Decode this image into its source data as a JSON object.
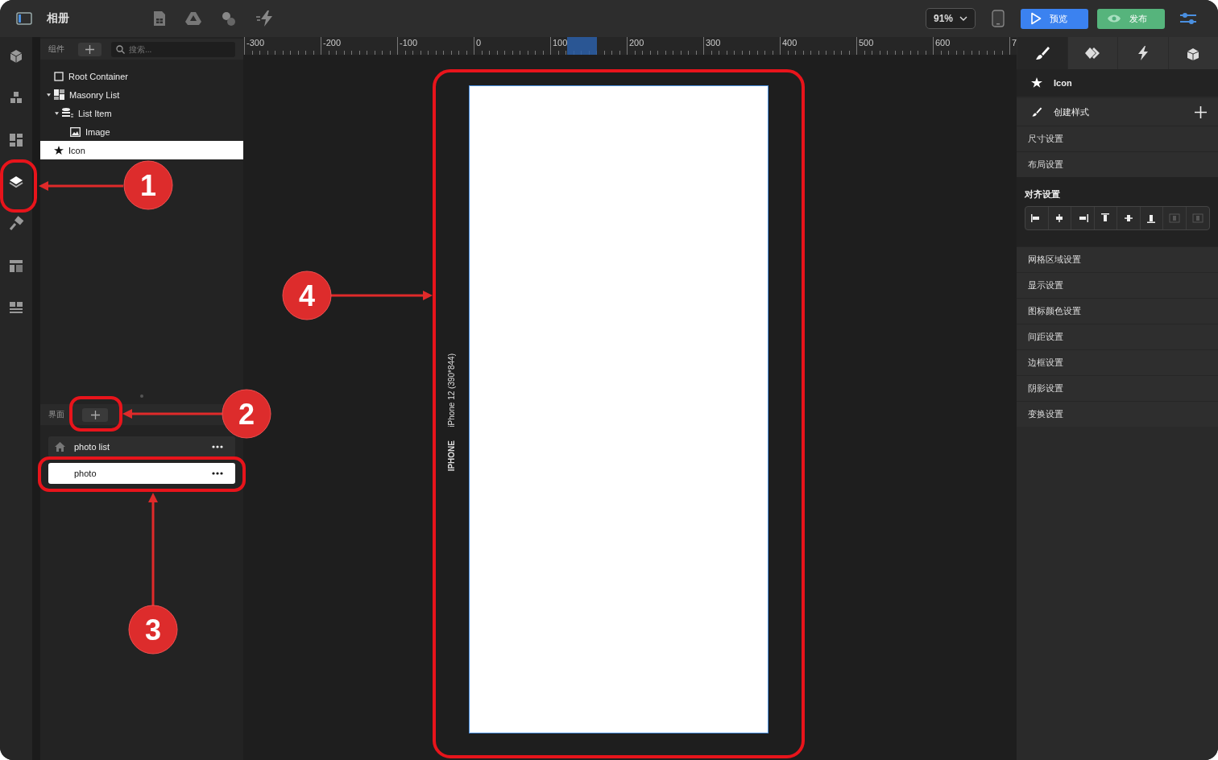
{
  "app": {
    "title": "相册"
  },
  "zoom": "91%",
  "buttons": [
    {
      "label": "预览",
      "kind": "preview"
    },
    {
      "label": "发布",
      "kind": "publish"
    }
  ],
  "rail_items": [
    {
      "selected": false
    },
    {
      "selected": false
    },
    {
      "selected": false
    },
    {
      "selected": true
    },
    {
      "selected": false
    },
    {
      "selected": false
    },
    {
      "selected": false
    }
  ],
  "components_panel": {
    "label": "组件",
    "search": {
      "placeholder": "搜索..."
    }
  },
  "tree": [
    {
      "label": "Root Container",
      "kind": "container",
      "selected": false
    },
    {
      "label": "Masonry List",
      "kind": "masonry",
      "expanded": true,
      "selected": false,
      "children": [
        {
          "label": "List Item",
          "kind": "list-item",
          "expanded": true,
          "selected": false,
          "children": [
            {
              "label": "Image",
              "kind": "image",
              "selected": false
            }
          ]
        }
      ]
    },
    {
      "label": "Icon",
      "kind": "icon",
      "selected": true
    }
  ],
  "pages_panel": {
    "label": "界面"
  },
  "pages": [
    {
      "label": "photo list",
      "home": true,
      "selected": false
    },
    {
      "label": "photo",
      "home": false,
      "selected": true
    }
  ],
  "ruler": [
    "-300",
    "-200",
    "-100",
    "0",
    "100",
    "200",
    "300",
    "400",
    "500",
    "600",
    "7"
  ],
  "device": {
    "name": "IPHONE",
    "model": "iPhone 12 (390*844)"
  },
  "inspector": {
    "tabs": [
      {
        "selected": true
      },
      {
        "selected": false
      },
      {
        "selected": false
      },
      {
        "selected": false
      }
    ],
    "element": "Icon",
    "create_style": "创建样式",
    "sections_top": [
      "尺寸设置",
      "布局设置"
    ],
    "align": {
      "title": "对齐设置",
      "buttons": [
        {
          "disabled": false
        },
        {
          "disabled": false
        },
        {
          "disabled": false
        },
        {
          "disabled": false
        },
        {
          "disabled": false
        },
        {
          "disabled": false
        },
        {
          "disabled": true
        },
        {
          "disabled": true
        }
      ]
    },
    "sections": [
      "网格区域设置",
      "显示设置",
      "图标颜色设置",
      "间距设置",
      "边框设置",
      "阴影设置",
      "变换设置"
    ]
  },
  "annotations": [
    {
      "number": "1"
    },
    {
      "number": "2"
    },
    {
      "number": "3"
    },
    {
      "number": "4"
    }
  ]
}
